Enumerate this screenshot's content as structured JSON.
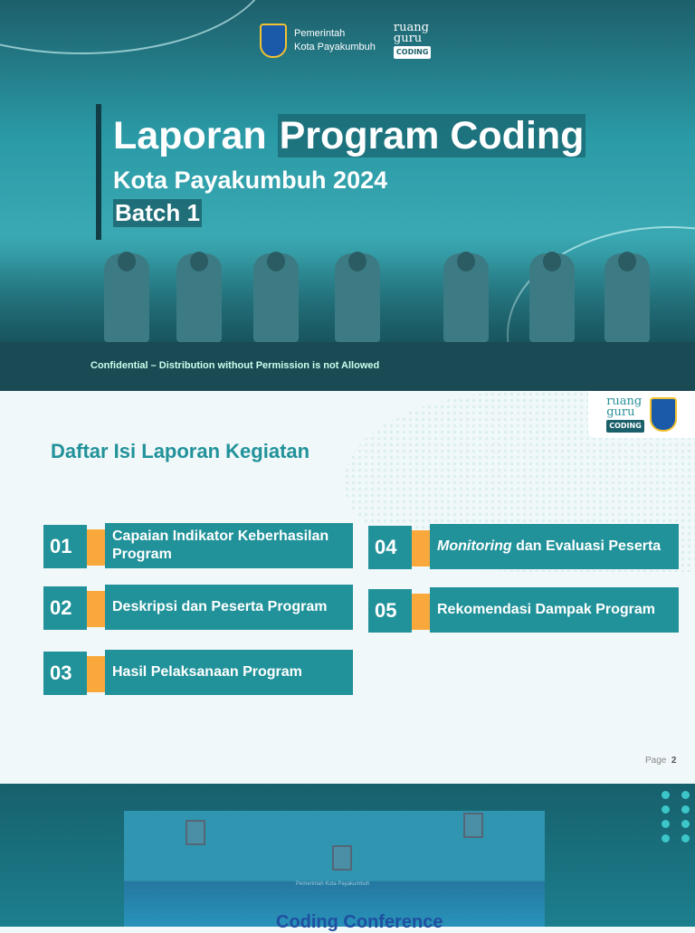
{
  "header": {
    "gov_line1": "Pemerintah",
    "gov_line2": "Kota Payakumbuh",
    "brand_line1": "ruang",
    "brand_line2": "guru",
    "brand_badge": "CODING"
  },
  "cover": {
    "title_part1": "Laporan ",
    "title_part2": "Program Coding",
    "subtitle": "Kota Payakumbuh 2024",
    "batch": "Batch 1",
    "confidential": "Confidential – Distribution without Permission is not Allowed"
  },
  "toc": {
    "heading": "Daftar Isi Laporan Kegiatan",
    "items": [
      {
        "num": "01",
        "label": "Capaian Indikator Keberhasilan Program"
      },
      {
        "num": "02",
        "label": "Deskripsi dan Peserta Program"
      },
      {
        "num": "03",
        "label": "Hasil Pelaksanaan Program"
      },
      {
        "num": "04",
        "label_italic": "Monitoring",
        "label": " dan Evaluasi Peserta"
      },
      {
        "num": "05",
        "label": "Rekomendasi Dampak Program"
      }
    ],
    "page_label": "Page",
    "page_num": "2"
  },
  "bottom": {
    "banner_text": "Coding Conference",
    "banner_gov1": "Pemerintah",
    "banner_gov2": "Kota Payakumbuh"
  },
  "colors": {
    "teal": "#21929a",
    "orange": "#f9a93c"
  }
}
